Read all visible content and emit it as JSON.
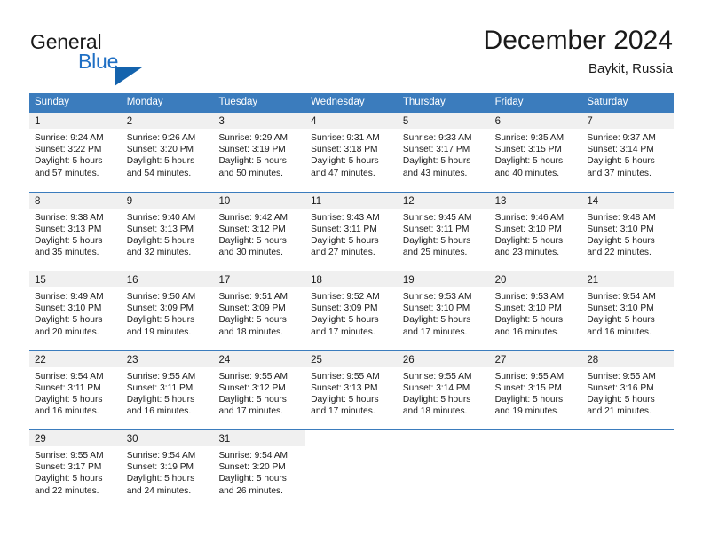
{
  "logo": {
    "word1": "General",
    "word2": "Blue",
    "triangle_color": "#1463ad",
    "blue_text_color": "#1f6fc4"
  },
  "header": {
    "title": "December 2024",
    "location": "Baykit, Russia"
  },
  "theme": {
    "header_blue": "#3b7cbd",
    "day_band_gray": "#f0f0f0",
    "text_dark": "#1a1a1a"
  },
  "weekday_headers": [
    "Sunday",
    "Monday",
    "Tuesday",
    "Wednesday",
    "Thursday",
    "Friday",
    "Saturday"
  ],
  "weeks": [
    [
      {
        "day": "1",
        "sunrise": "Sunrise: 9:24 AM",
        "sunset": "Sunset: 3:22 PM",
        "daylight1": "Daylight: 5 hours",
        "daylight2": "and 57 minutes."
      },
      {
        "day": "2",
        "sunrise": "Sunrise: 9:26 AM",
        "sunset": "Sunset: 3:20 PM",
        "daylight1": "Daylight: 5 hours",
        "daylight2": "and 54 minutes."
      },
      {
        "day": "3",
        "sunrise": "Sunrise: 9:29 AM",
        "sunset": "Sunset: 3:19 PM",
        "daylight1": "Daylight: 5 hours",
        "daylight2": "and 50 minutes."
      },
      {
        "day": "4",
        "sunrise": "Sunrise: 9:31 AM",
        "sunset": "Sunset: 3:18 PM",
        "daylight1": "Daylight: 5 hours",
        "daylight2": "and 47 minutes."
      },
      {
        "day": "5",
        "sunrise": "Sunrise: 9:33 AM",
        "sunset": "Sunset: 3:17 PM",
        "daylight1": "Daylight: 5 hours",
        "daylight2": "and 43 minutes."
      },
      {
        "day": "6",
        "sunrise": "Sunrise: 9:35 AM",
        "sunset": "Sunset: 3:15 PM",
        "daylight1": "Daylight: 5 hours",
        "daylight2": "and 40 minutes."
      },
      {
        "day": "7",
        "sunrise": "Sunrise: 9:37 AM",
        "sunset": "Sunset: 3:14 PM",
        "daylight1": "Daylight: 5 hours",
        "daylight2": "and 37 minutes."
      }
    ],
    [
      {
        "day": "8",
        "sunrise": "Sunrise: 9:38 AM",
        "sunset": "Sunset: 3:13 PM",
        "daylight1": "Daylight: 5 hours",
        "daylight2": "and 35 minutes."
      },
      {
        "day": "9",
        "sunrise": "Sunrise: 9:40 AM",
        "sunset": "Sunset: 3:13 PM",
        "daylight1": "Daylight: 5 hours",
        "daylight2": "and 32 minutes."
      },
      {
        "day": "10",
        "sunrise": "Sunrise: 9:42 AM",
        "sunset": "Sunset: 3:12 PM",
        "daylight1": "Daylight: 5 hours",
        "daylight2": "and 30 minutes."
      },
      {
        "day": "11",
        "sunrise": "Sunrise: 9:43 AM",
        "sunset": "Sunset: 3:11 PM",
        "daylight1": "Daylight: 5 hours",
        "daylight2": "and 27 minutes."
      },
      {
        "day": "12",
        "sunrise": "Sunrise: 9:45 AM",
        "sunset": "Sunset: 3:11 PM",
        "daylight1": "Daylight: 5 hours",
        "daylight2": "and 25 minutes."
      },
      {
        "day": "13",
        "sunrise": "Sunrise: 9:46 AM",
        "sunset": "Sunset: 3:10 PM",
        "daylight1": "Daylight: 5 hours",
        "daylight2": "and 23 minutes."
      },
      {
        "day": "14",
        "sunrise": "Sunrise: 9:48 AM",
        "sunset": "Sunset: 3:10 PM",
        "daylight1": "Daylight: 5 hours",
        "daylight2": "and 22 minutes."
      }
    ],
    [
      {
        "day": "15",
        "sunrise": "Sunrise: 9:49 AM",
        "sunset": "Sunset: 3:10 PM",
        "daylight1": "Daylight: 5 hours",
        "daylight2": "and 20 minutes."
      },
      {
        "day": "16",
        "sunrise": "Sunrise: 9:50 AM",
        "sunset": "Sunset: 3:09 PM",
        "daylight1": "Daylight: 5 hours",
        "daylight2": "and 19 minutes."
      },
      {
        "day": "17",
        "sunrise": "Sunrise: 9:51 AM",
        "sunset": "Sunset: 3:09 PM",
        "daylight1": "Daylight: 5 hours",
        "daylight2": "and 18 minutes."
      },
      {
        "day": "18",
        "sunrise": "Sunrise: 9:52 AM",
        "sunset": "Sunset: 3:09 PM",
        "daylight1": "Daylight: 5 hours",
        "daylight2": "and 17 minutes."
      },
      {
        "day": "19",
        "sunrise": "Sunrise: 9:53 AM",
        "sunset": "Sunset: 3:10 PM",
        "daylight1": "Daylight: 5 hours",
        "daylight2": "and 17 minutes."
      },
      {
        "day": "20",
        "sunrise": "Sunrise: 9:53 AM",
        "sunset": "Sunset: 3:10 PM",
        "daylight1": "Daylight: 5 hours",
        "daylight2": "and 16 minutes."
      },
      {
        "day": "21",
        "sunrise": "Sunrise: 9:54 AM",
        "sunset": "Sunset: 3:10 PM",
        "daylight1": "Daylight: 5 hours",
        "daylight2": "and 16 minutes."
      }
    ],
    [
      {
        "day": "22",
        "sunrise": "Sunrise: 9:54 AM",
        "sunset": "Sunset: 3:11 PM",
        "daylight1": "Daylight: 5 hours",
        "daylight2": "and 16 minutes."
      },
      {
        "day": "23",
        "sunrise": "Sunrise: 9:55 AM",
        "sunset": "Sunset: 3:11 PM",
        "daylight1": "Daylight: 5 hours",
        "daylight2": "and 16 minutes."
      },
      {
        "day": "24",
        "sunrise": "Sunrise: 9:55 AM",
        "sunset": "Sunset: 3:12 PM",
        "daylight1": "Daylight: 5 hours",
        "daylight2": "and 17 minutes."
      },
      {
        "day": "25",
        "sunrise": "Sunrise: 9:55 AM",
        "sunset": "Sunset: 3:13 PM",
        "daylight1": "Daylight: 5 hours",
        "daylight2": "and 17 minutes."
      },
      {
        "day": "26",
        "sunrise": "Sunrise: 9:55 AM",
        "sunset": "Sunset: 3:14 PM",
        "daylight1": "Daylight: 5 hours",
        "daylight2": "and 18 minutes."
      },
      {
        "day": "27",
        "sunrise": "Sunrise: 9:55 AM",
        "sunset": "Sunset: 3:15 PM",
        "daylight1": "Daylight: 5 hours",
        "daylight2": "and 19 minutes."
      },
      {
        "day": "28",
        "sunrise": "Sunrise: 9:55 AM",
        "sunset": "Sunset: 3:16 PM",
        "daylight1": "Daylight: 5 hours",
        "daylight2": "and 21 minutes."
      }
    ],
    [
      {
        "day": "29",
        "sunrise": "Sunrise: 9:55 AM",
        "sunset": "Sunset: 3:17 PM",
        "daylight1": "Daylight: 5 hours",
        "daylight2": "and 22 minutes."
      },
      {
        "day": "30",
        "sunrise": "Sunrise: 9:54 AM",
        "sunset": "Sunset: 3:19 PM",
        "daylight1": "Daylight: 5 hours",
        "daylight2": "and 24 minutes."
      },
      {
        "day": "31",
        "sunrise": "Sunrise: 9:54 AM",
        "sunset": "Sunset: 3:20 PM",
        "daylight1": "Daylight: 5 hours",
        "daylight2": "and 26 minutes."
      },
      {
        "day": "",
        "sunrise": "",
        "sunset": "",
        "daylight1": "",
        "daylight2": ""
      },
      {
        "day": "",
        "sunrise": "",
        "sunset": "",
        "daylight1": "",
        "daylight2": ""
      },
      {
        "day": "",
        "sunrise": "",
        "sunset": "",
        "daylight1": "",
        "daylight2": ""
      },
      {
        "day": "",
        "sunrise": "",
        "sunset": "",
        "daylight1": "",
        "daylight2": ""
      }
    ]
  ]
}
